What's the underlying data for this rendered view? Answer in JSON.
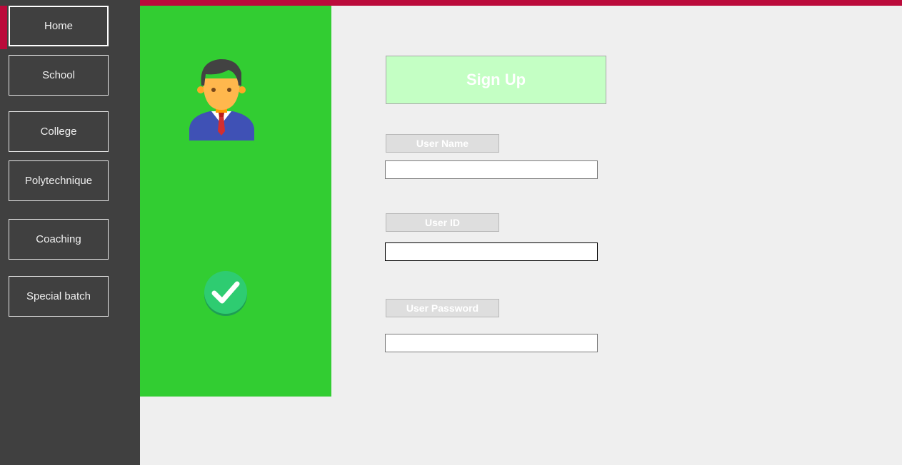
{
  "sidebar": {
    "items": [
      {
        "label": "Home"
      },
      {
        "label": "School"
      },
      {
        "label": "College"
      },
      {
        "label": "Polytechnique"
      },
      {
        "label": "Coaching"
      },
      {
        "label": "Special batch"
      }
    ],
    "active_item": "Home"
  },
  "form": {
    "title": "Sign Up",
    "fields": [
      {
        "label": "User Name",
        "value": ""
      },
      {
        "label": "User ID",
        "value": ""
      },
      {
        "label": "User Password",
        "value": ""
      }
    ]
  },
  "icons": {
    "avatar": "user-avatar-icon",
    "submit": "checkmark-icon"
  },
  "colors": {
    "accent": "#bb0b3b",
    "sidebar": "#404040",
    "panel": "#32cd32",
    "title_bg": "#c4ffc4",
    "background": "#efefef"
  }
}
